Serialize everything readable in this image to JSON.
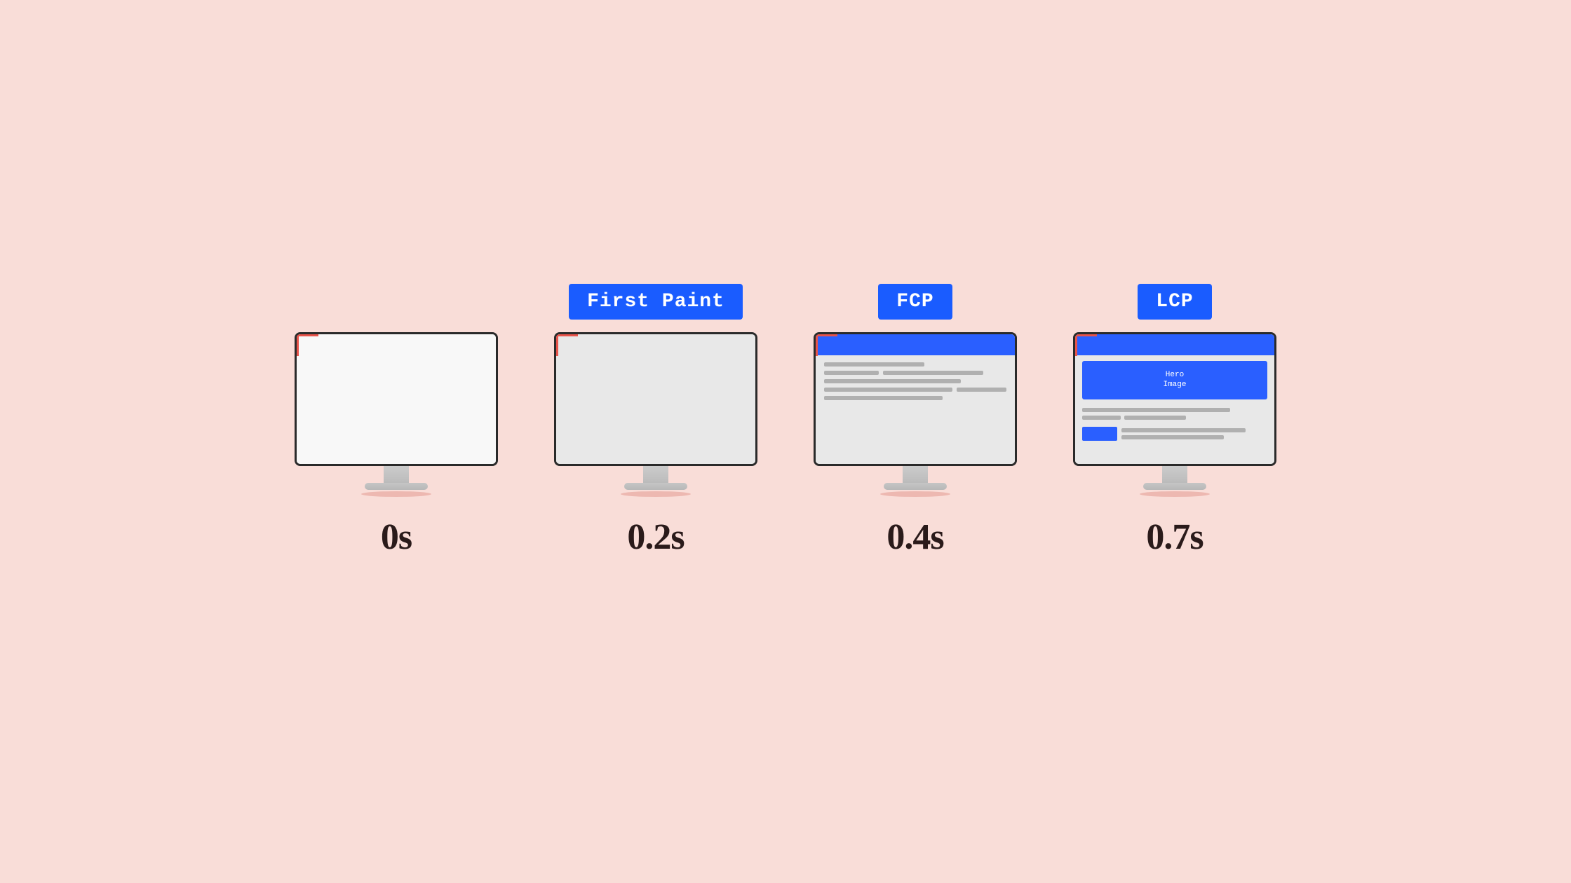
{
  "stages": [
    {
      "id": "stage-0s",
      "badge_visible": false,
      "badge_text": "",
      "time_label": "0s",
      "screen_type": "blank"
    },
    {
      "id": "stage-02s",
      "badge_visible": true,
      "badge_text": "First Paint",
      "time_label": "0.2s",
      "screen_type": "first-paint"
    },
    {
      "id": "stage-04s",
      "badge_visible": true,
      "badge_text": "FCP",
      "time_label": "0.4s",
      "screen_type": "fcp"
    },
    {
      "id": "stage-07s",
      "badge_visible": true,
      "badge_text": "LCP",
      "time_label": "0.7s",
      "screen_type": "lcp"
    }
  ],
  "hero_image_text": "Hero\nImage"
}
